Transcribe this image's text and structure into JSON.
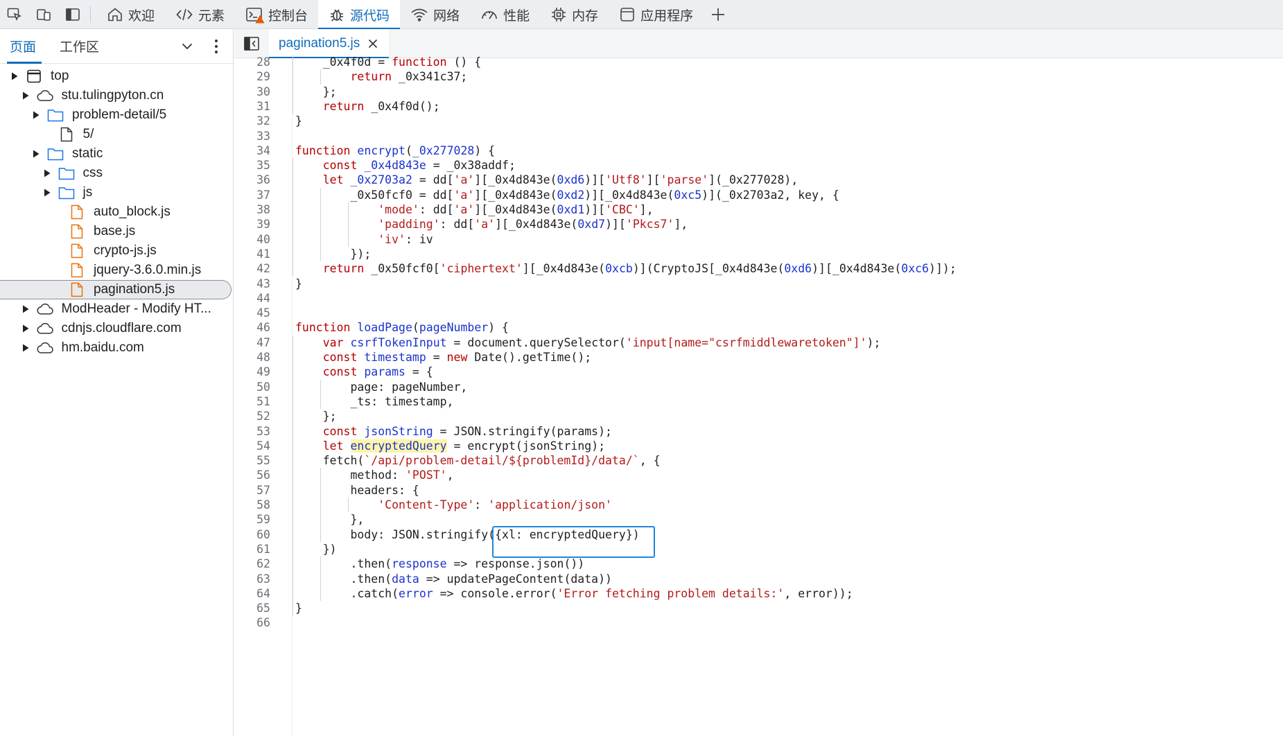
{
  "toolbar": {
    "tabs": [
      {
        "label": "欢迎",
        "icon": "home-icon"
      },
      {
        "label": "元素",
        "icon": "code-brackets-icon"
      },
      {
        "label": "控制台",
        "icon": "console-icon"
      },
      {
        "label": "源代码",
        "icon": "bug-icon"
      },
      {
        "label": "网络",
        "icon": "wifi-icon"
      },
      {
        "label": "性能",
        "icon": "gauge-icon"
      },
      {
        "label": "内存",
        "icon": "chip-icon"
      },
      {
        "label": "应用程序",
        "icon": "app-window-icon"
      }
    ],
    "active_tab": "源代码",
    "accent": "#0f6cbd",
    "warning_color": "#e8590c"
  },
  "navigator": {
    "tabs": [
      "页面",
      "工作区"
    ],
    "active": "页面",
    "tree": [
      {
        "label": "top",
        "icon": "window-icon",
        "expanded": true
      },
      {
        "label": "stu.tulingpyton.cn",
        "icon": "cloud-icon",
        "expanded": true
      },
      {
        "label": "problem-detail/5",
        "icon": "folder-icon",
        "expanded": true
      },
      {
        "label": "5/",
        "icon": "file-icon"
      },
      {
        "label": "static",
        "icon": "folder-icon",
        "expanded": true
      },
      {
        "label": "css",
        "icon": "folder-icon",
        "expanded": false
      },
      {
        "label": "js",
        "icon": "folder-icon",
        "expanded": true
      },
      {
        "label": "auto_block.js",
        "icon": "js-file-icon"
      },
      {
        "label": "base.js",
        "icon": "js-file-icon"
      },
      {
        "label": "crypto-js.js",
        "icon": "js-file-icon"
      },
      {
        "label": "jquery-3.6.0.min.js",
        "icon": "js-file-icon"
      },
      {
        "label": "pagination5.js",
        "icon": "js-file-icon",
        "selected": true
      },
      {
        "label": "ModHeader - Modify HT...",
        "icon": "cloud-icon",
        "expanded": false
      },
      {
        "label": "cdnjs.cloudflare.com",
        "icon": "cloud-icon",
        "expanded": false
      },
      {
        "label": "hm.baidu.com",
        "icon": "cloud-icon",
        "expanded": false
      }
    ]
  },
  "editor": {
    "open_file": "pagination5.js",
    "highlight_color": "#1f86d9",
    "lines": [
      {
        "n": "28",
        "text": "    _0x4f0d = function () {"
      },
      {
        "n": "29",
        "text": "        return _0x341c37;"
      },
      {
        "n": "30",
        "text": "    };"
      },
      {
        "n": "31",
        "text": "    return _0x4f0d();"
      },
      {
        "n": "32",
        "text": "}"
      },
      {
        "n": "33",
        "text": ""
      },
      {
        "n": "34",
        "text": "function encrypt(_0x277028) {"
      },
      {
        "n": "35",
        "text": "    const _0x4d843e = _0x38addf;"
      },
      {
        "n": "36",
        "text": "    let _0x2703a2 = dd['a'][_0x4d843e(0xd6)]['Utf8']['parse'](_0x277028),"
      },
      {
        "n": "37",
        "text": "        _0x50fcf0 = dd['a'][_0x4d843e(0xd2)][_0x4d843e(0xc5)](_0x2703a2, key, {"
      },
      {
        "n": "38",
        "text": "            'mode': dd['a'][_0x4d843e(0xd1)]['CBC'],"
      },
      {
        "n": "39",
        "text": "            'padding': dd['a'][_0x4d843e(0xd7)]['Pkcs7'],"
      },
      {
        "n": "40",
        "text": "            'iv': iv"
      },
      {
        "n": "41",
        "text": "        });"
      },
      {
        "n": "42",
        "text": "    return _0x50fcf0['ciphertext'][_0x4d843e(0xcb)](CryptoJS[_0x4d843e(0xd6)][_0x4d843e(0xc6)]);"
      },
      {
        "n": "43",
        "text": "}"
      },
      {
        "n": "44",
        "text": ""
      },
      {
        "n": "45",
        "text": ""
      },
      {
        "n": "46",
        "text": "function loadPage(pageNumber) {"
      },
      {
        "n": "47",
        "text": "    var csrfTokenInput = document.querySelector('input[name=\"csrfmiddlewaretoken\"]');"
      },
      {
        "n": "48",
        "text": "    const timestamp = new Date().getTime();"
      },
      {
        "n": "49",
        "text": "    const params = {"
      },
      {
        "n": "50",
        "text": "        page: pageNumber,"
      },
      {
        "n": "51",
        "text": "        _ts: timestamp,"
      },
      {
        "n": "52",
        "text": "    };"
      },
      {
        "n": "53",
        "text": "    const jsonString = JSON.stringify(params);"
      },
      {
        "n": "54",
        "text": "    let encryptedQuery = encrypt(jsonString);"
      },
      {
        "n": "55",
        "text": "    fetch(`/api/problem-detail/${problemId}/data/`, {"
      },
      {
        "n": "56",
        "text": "        method: 'POST',"
      },
      {
        "n": "57",
        "text": "        headers: {"
      },
      {
        "n": "58",
        "text": "            'Content-Type': 'application/json'"
      },
      {
        "n": "59",
        "text": "        },"
      },
      {
        "n": "60",
        "text": "        body: JSON.stringify({xl: encryptedQuery})"
      },
      {
        "n": "61",
        "text": "    })"
      },
      {
        "n": "62",
        "text": "        .then(response => response.json())"
      },
      {
        "n": "63",
        "text": "        .then(data => updatePageContent(data))"
      },
      {
        "n": "64",
        "text": "        .catch(error => console.error('Error fetching problem details:', error));"
      },
      {
        "n": "65",
        "text": "}"
      },
      {
        "n": "66",
        "text": ""
      }
    ]
  }
}
